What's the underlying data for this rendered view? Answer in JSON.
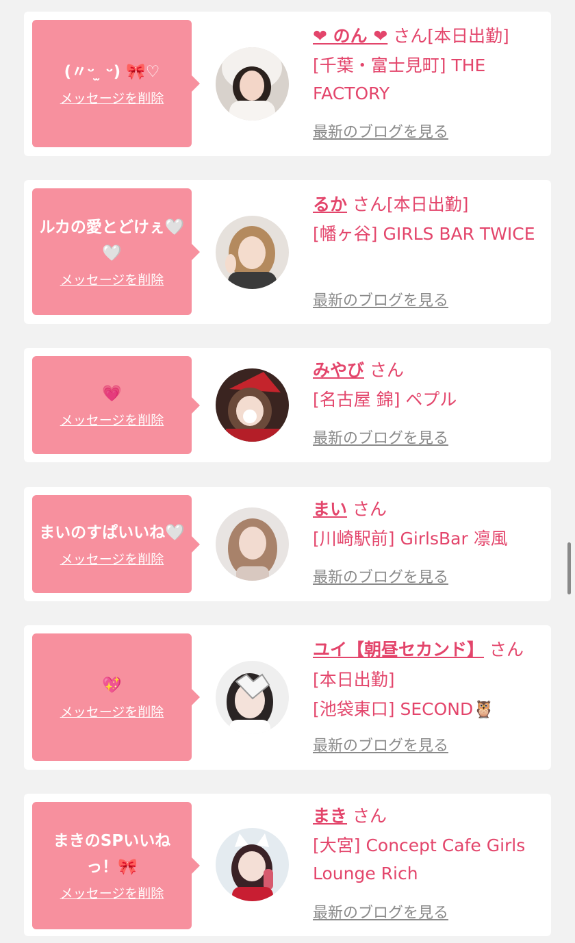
{
  "cards": [
    {
      "message": "(〃ᵕ︎ ̫ ᵕ︎) 🎀♡",
      "delete_label": "メッセージを削除",
      "name": "❤︎ のん ❤︎",
      "honorific": "さん[本日出勤]",
      "shop": "[千葉・富士見町] THE FACTORY",
      "blog_label": "最新のブログを見る"
    },
    {
      "message": "ルカの愛とどけぇ🤍🤍",
      "delete_label": "メッセージを削除",
      "name": "るか",
      "honorific": "さん[本日出勤]",
      "shop": "[幡ヶ谷] GIRLS BAR TWICE",
      "blog_label": "最新のブログを見る"
    },
    {
      "message": "💗",
      "delete_label": "メッセージを削除",
      "name": "みやび",
      "honorific": "さん",
      "shop": "[名古屋 錦] ペプル",
      "blog_label": "最新のブログを見る"
    },
    {
      "message": "まいのすぱいいね🤍",
      "delete_label": "メッセージを削除",
      "name": "まい",
      "honorific": "さん",
      "shop": "[川崎駅前] GirlsBar 凛風",
      "blog_label": "最新のブログを見る"
    },
    {
      "message": "💖",
      "delete_label": "メッセージを削除",
      "name": "ユイ【朝昼セカンド】",
      "honorific": "さん[本日出勤]",
      "shop": "[池袋東口] SECOND🦉",
      "blog_label": "最新のブログを見る"
    },
    {
      "message": "まきのSPいいねっ！🎀",
      "delete_label": "メッセージを削除",
      "name": "まき",
      "honorific": "さん",
      "shop": "[大宮] Concept Cafe Girls Lounge Rich",
      "blog_label": "最新のブログを見る"
    }
  ],
  "colors": {
    "accent": "#e3456b",
    "bubble": "#f7909e",
    "background": "#f2f2f2",
    "muted": "#8a8a8a"
  },
  "icons": [
    "avatar-photo"
  ]
}
